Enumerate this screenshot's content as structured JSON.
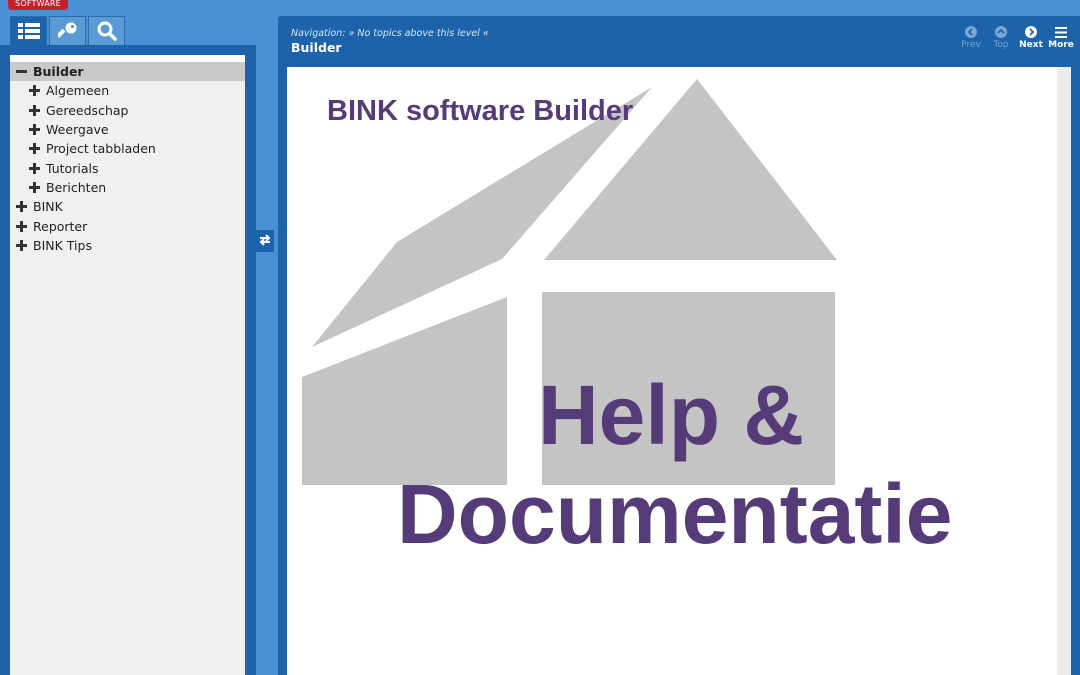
{
  "logo": {
    "text": "SOFTWARE"
  },
  "tabs": [
    {
      "name": "contents",
      "icon": "list-icon",
      "active": true
    },
    {
      "name": "index",
      "icon": "key-icon",
      "active": false
    },
    {
      "name": "search",
      "icon": "search-icon",
      "active": false
    }
  ],
  "tree": {
    "items": [
      {
        "label": "Builder",
        "level": 0,
        "expanded": true,
        "selected": true
      },
      {
        "label": "Algemeen",
        "level": 1,
        "expanded": false
      },
      {
        "label": "Gereedschap",
        "level": 1,
        "expanded": false
      },
      {
        "label": "Weergave",
        "level": 1,
        "expanded": false
      },
      {
        "label": "Project tabbladen",
        "level": 1,
        "expanded": false
      },
      {
        "label": "Tutorials",
        "level": 1,
        "expanded": false
      },
      {
        "label": "Berichten",
        "level": 1,
        "expanded": false
      },
      {
        "label": "BINK",
        "level": 0,
        "expanded": false
      },
      {
        "label": "Reporter",
        "level": 0,
        "expanded": false
      },
      {
        "label": "BINK Tips",
        "level": 0,
        "expanded": false
      }
    ]
  },
  "header": {
    "nav_label": "Navigation:",
    "nav_text": "» No topics above this level «",
    "topic_title": "Builder"
  },
  "nav_buttons": [
    {
      "label": "Prev",
      "icon": "prev-icon",
      "enabled": false
    },
    {
      "label": "Top",
      "icon": "top-icon",
      "enabled": false
    },
    {
      "label": "Next",
      "icon": "next-icon",
      "enabled": true
    },
    {
      "label": "More",
      "icon": "menu-icon",
      "enabled": true
    }
  ],
  "content": {
    "title": "BINK software Builder",
    "headline_line1": "Help &",
    "headline_line2": "Documentatie"
  },
  "colors": {
    "accent_blue": "#1d63ab",
    "background_blue": "#4a90d4",
    "brand_purple": "#553c78",
    "house_gray": "#c4c4c4",
    "logo_red": "#c3202f"
  }
}
